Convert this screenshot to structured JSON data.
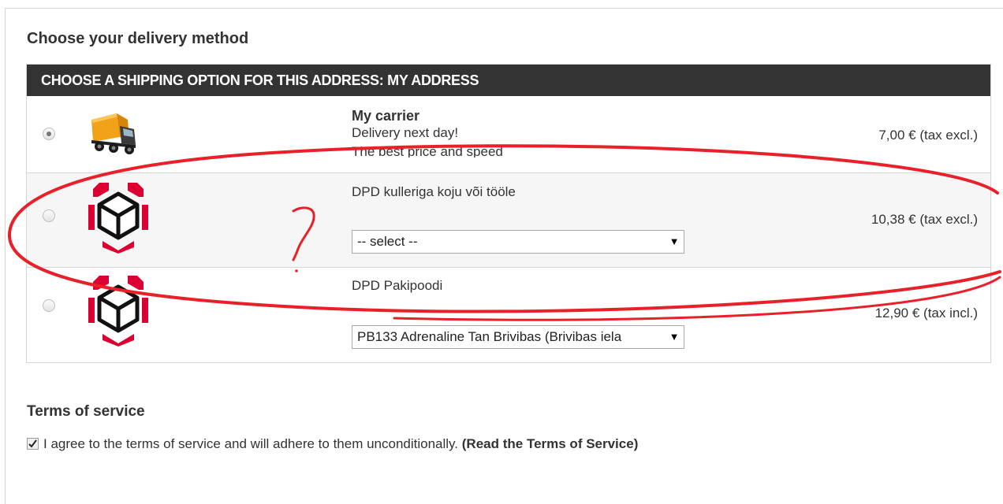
{
  "page": {
    "title": "Choose your delivery method"
  },
  "shipping": {
    "header": "CHOOSE A SHIPPING OPTION FOR THIS ADDRESS: MY ADDRESS",
    "options": [
      {
        "name": "My carrier",
        "description_line1": "Delivery next day!",
        "description_line2": "The best price and speed",
        "price": "7,00 € (tax excl.)",
        "selected": true,
        "logo": "truck-icon"
      },
      {
        "name": "DPD kulleriga koju või tööle",
        "select_value": "-- select --",
        "price": "10,38 € (tax excl.)",
        "selected": false,
        "logo": "dpd-box-icon"
      },
      {
        "name": "DPD Pakipoodi",
        "select_value": "PB133 Adrenaline Tan Brivibas (Brivibas iela",
        "price": "12,90 € (tax incl.)",
        "selected": false,
        "logo": "dpd-box-icon"
      }
    ]
  },
  "terms": {
    "title": "Terms of service",
    "agree_text": "I agree to the terms of service and will adhere to them unconditionally.",
    "link_text": "(Read the Terms of Service)",
    "checked": true
  },
  "colors": {
    "header_bg": "#333333",
    "annotation_red": "#e8202a",
    "dpd_red": "#dc0032"
  }
}
